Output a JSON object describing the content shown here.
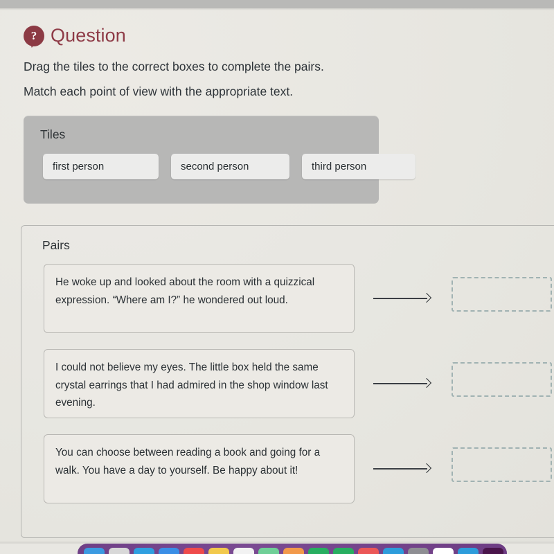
{
  "header": {
    "icon_name": "question-mark-bubble-icon",
    "title": "Question",
    "title_color": "#8e3b47",
    "icon_glyph": "?"
  },
  "instructions": {
    "line1": "Drag the tiles to the correct boxes to complete the pairs.",
    "line2": "Match each point of view with the appropriate text."
  },
  "tiles_panel": {
    "title": "Tiles",
    "background_color": "#b7b7b6",
    "tiles": [
      {
        "label": "first person"
      },
      {
        "label": "second person"
      },
      {
        "label": "third person"
      }
    ]
  },
  "pairs_panel": {
    "title": "Pairs",
    "arrow_glyph": "→",
    "dropzone_border_color": "#a0b2b2",
    "rows": [
      {
        "text": "He woke up and looked about the room with a quizzical expression. “Where am I?” he wondered out loud.",
        "dropzone_value": ""
      },
      {
        "text": "I could not believe my eyes. The little box held the same crystal earrings that I had admired in the shop window last evening.",
        "dropzone_value": ""
      },
      {
        "text": "You can choose between reading a book and going for a walk. You have a day to yourself. Be happy about it!",
        "dropzone_value": ""
      }
    ]
  },
  "dock": {
    "accent_color": "#7a4a92",
    "icons": [
      {
        "name": "finder-icon",
        "color": "#3b9ae1"
      },
      {
        "name": "launchpad-icon",
        "color": "#d8d8d8"
      },
      {
        "name": "safari-icon",
        "color": "#2f9fe0"
      },
      {
        "name": "mail-icon",
        "color": "#3a8ee6"
      },
      {
        "name": "calendar-icon",
        "color": "#ef4b4b"
      },
      {
        "name": "notes-icon",
        "color": "#f2c94c"
      },
      {
        "name": "reminders-icon",
        "color": "#f2f2f2"
      },
      {
        "name": "maps-icon",
        "color": "#6fcf97"
      },
      {
        "name": "photos-icon",
        "color": "#f2994a"
      },
      {
        "name": "messages-icon",
        "color": "#27ae60"
      },
      {
        "name": "facetime-icon",
        "color": "#27ae60"
      },
      {
        "name": "music-icon",
        "color": "#eb5757"
      },
      {
        "name": "appstore-icon",
        "color": "#2d9cdb"
      },
      {
        "name": "system-settings-icon",
        "color": "#8e8e93"
      },
      {
        "name": "browser-icon",
        "color": "#ffffff"
      },
      {
        "name": "zoom-icon",
        "color": "#2d9cdb"
      },
      {
        "name": "slack-icon",
        "color": "#4a154b"
      },
      {
        "name": "terminal-icon",
        "color": "#1f1f1f"
      },
      {
        "name": "trash-icon",
        "color": "#cfcfcf"
      }
    ]
  }
}
